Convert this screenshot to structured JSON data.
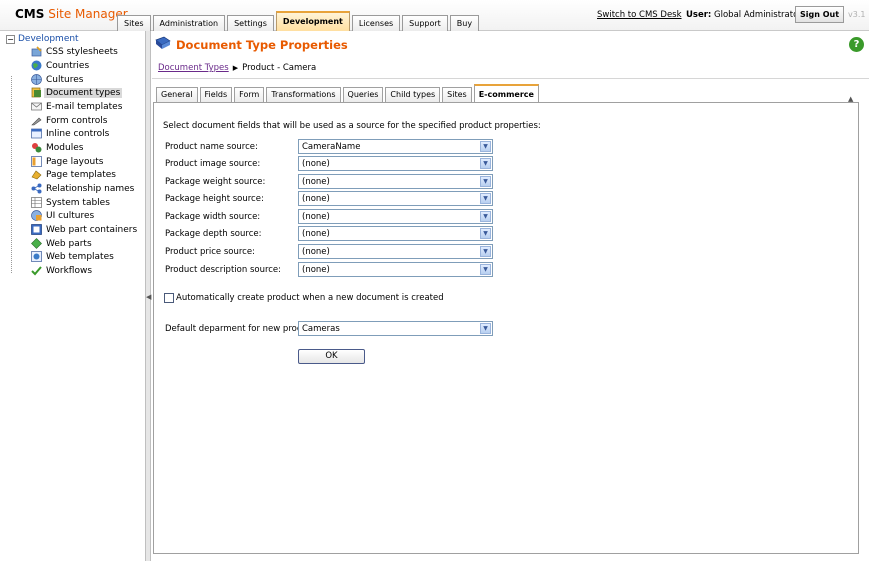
{
  "header": {
    "logo_bold": "CMS",
    "logo_rest": " Site Manager",
    "tabs": [
      {
        "label": "Sites"
      },
      {
        "label": "Administration"
      },
      {
        "label": "Settings"
      },
      {
        "label": "Development",
        "active": true
      },
      {
        "label": "Licenses"
      },
      {
        "label": "Support"
      },
      {
        "label": "Buy"
      }
    ],
    "switch_link": "Switch to CMS Desk",
    "user_label": "User:",
    "user_name": "Global Administrator",
    "signout_label": "Sign Out",
    "version": "v3.1"
  },
  "tree": {
    "root_label": "Development",
    "root_expander": "−",
    "items": [
      {
        "label": "CSS stylesheets",
        "icon": "css-icon"
      },
      {
        "label": "Countries",
        "icon": "globe-icon"
      },
      {
        "label": "Cultures",
        "icon": "culture-icon"
      },
      {
        "label": "Document types",
        "icon": "document-type-icon",
        "selected": true
      },
      {
        "label": "E-mail templates",
        "icon": "email-icon"
      },
      {
        "label": "Form controls",
        "icon": "form-control-icon"
      },
      {
        "label": "Inline controls",
        "icon": "inline-control-icon"
      },
      {
        "label": "Modules",
        "icon": "module-icon"
      },
      {
        "label": "Page layouts",
        "icon": "layout-icon"
      },
      {
        "label": "Page templates",
        "icon": "template-icon"
      },
      {
        "label": "Relationship names",
        "icon": "relationship-icon"
      },
      {
        "label": "System tables",
        "icon": "table-icon"
      },
      {
        "label": "UI cultures",
        "icon": "ui-culture-icon"
      },
      {
        "label": "Web part containers",
        "icon": "container-icon"
      },
      {
        "label": "Web parts",
        "icon": "webpart-icon"
      },
      {
        "label": "Web templates",
        "icon": "web-template-icon"
      },
      {
        "label": "Workflows",
        "icon": "workflow-icon"
      }
    ]
  },
  "content": {
    "title": "Document Type Properties",
    "breadcrumb": {
      "link": "Document Types",
      "current": "Product - Camera"
    },
    "tabs": [
      {
        "label": "General"
      },
      {
        "label": "Fields"
      },
      {
        "label": "Form"
      },
      {
        "label": "Transformations"
      },
      {
        "label": "Queries"
      },
      {
        "label": "Child types"
      },
      {
        "label": "Sites"
      },
      {
        "label": "E-commerce",
        "active": true
      }
    ],
    "intro": "Select document fields that will be used as a source for the specified product properties:",
    "fields": [
      {
        "label": "Product name source:",
        "value": "CameraName"
      },
      {
        "label": "Product image source:",
        "value": "(none)"
      },
      {
        "label": "Package weight source:",
        "value": "(none)"
      },
      {
        "label": "Package height source:",
        "value": "(none)"
      },
      {
        "label": "Package width source:",
        "value": "(none)"
      },
      {
        "label": "Package depth source:",
        "value": "(none)"
      },
      {
        "label": "Product price source:",
        "value": "(none)"
      },
      {
        "label": "Product description source:",
        "value": "(none)"
      }
    ],
    "auto_create_label": "Automatically create product when a new document is created",
    "auto_create_checked": false,
    "department": {
      "label": "Default deparment for new product:",
      "value": "Cameras"
    },
    "ok_label": "OK"
  },
  "colors": {
    "accent_orange": "#e85a00",
    "tab_highlight": "#e8a33a",
    "link_purple": "#6a2a8a",
    "tree_root_blue": "#1a4fa8",
    "help_green": "#3a9a2a"
  }
}
